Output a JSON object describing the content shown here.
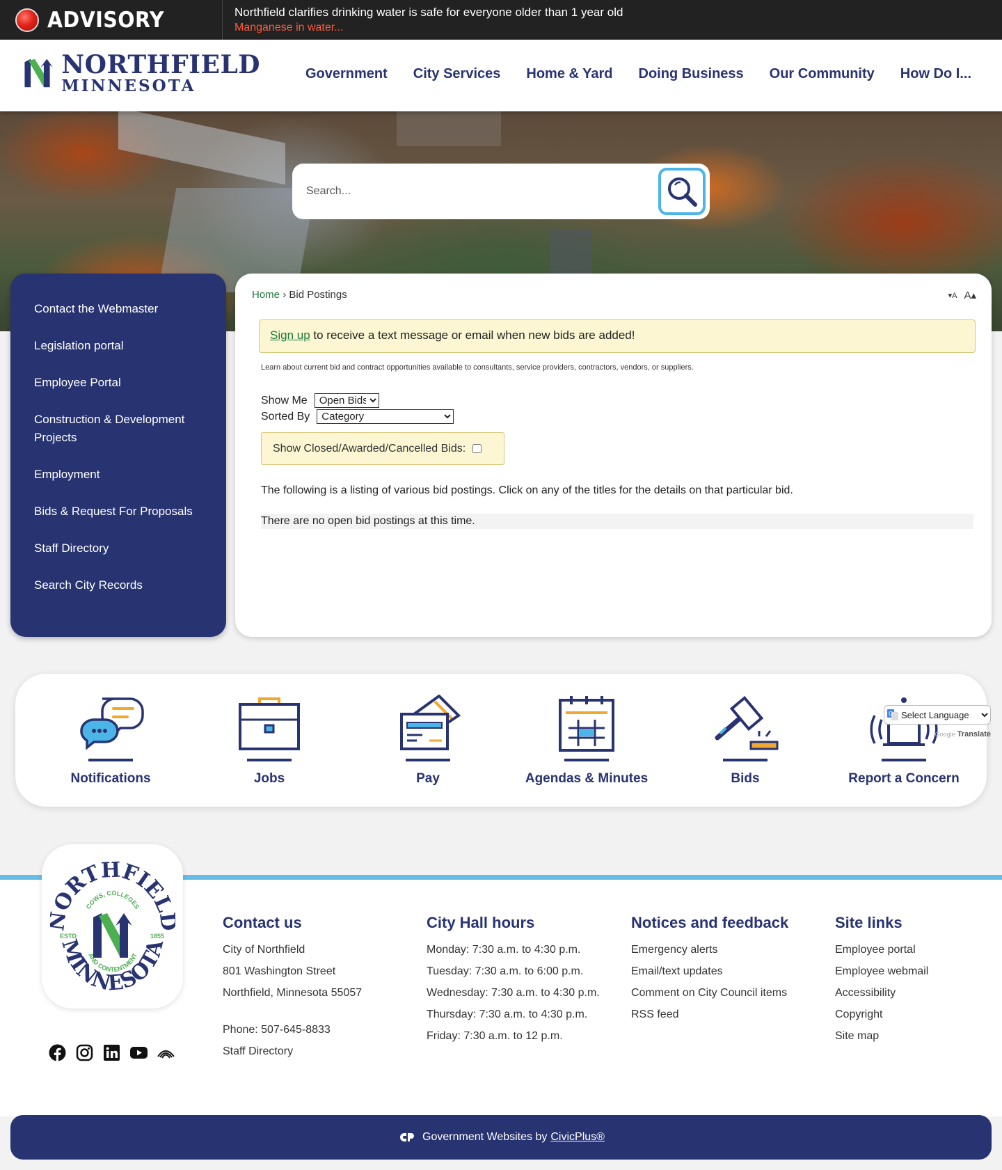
{
  "advisory": {
    "label": "ADVISORY",
    "title": "Northfield clarifies drinking water is safe for everyone older than 1 year old",
    "link": "Manganese in water..."
  },
  "logo": {
    "line1": "NORTHFIELD",
    "line2": "MINNESOTA"
  },
  "nav": {
    "items": [
      "Government",
      "City Services",
      "Home & Yard",
      "Doing Business",
      "Our Community",
      "How Do I..."
    ]
  },
  "search": {
    "placeholder": "Search..."
  },
  "sidebar": {
    "items": [
      "Contact the Webmaster",
      "Legislation portal",
      "Employee Portal",
      "Construction & Development Projects",
      "Employment",
      "Bids & Request For Proposals",
      "Staff Directory",
      "Search City Records"
    ]
  },
  "breadcrumb": {
    "home": "Home",
    "separator": "›",
    "current": "Bid Postings"
  },
  "font_resize": {
    "decrease": "▾A",
    "increase": "A▴"
  },
  "signup": {
    "link": "Sign up",
    "text": " to receive a text message or email when new bids are added!"
  },
  "learn_text": "Learn about current bid and contract opportunities available to consultants, service providers, contractors, vendors, or suppliers.",
  "filters": {
    "show_label": "Show Me",
    "show_value": "Open Bids",
    "sort_label": "Sorted By",
    "sort_value": "Category",
    "closed_label": "Show Closed/Awarded/Cancelled Bids:"
  },
  "listing_desc": "The following is a listing of various bid postings. Click on any of the titles for the details on that particular bid.",
  "no_bids": "There are no open bid postings at this time.",
  "quick_links": [
    {
      "label": "Notifications",
      "icon": "chat-bubbles-icon"
    },
    {
      "label": "Jobs",
      "icon": "briefcase-icon"
    },
    {
      "label": "Pay",
      "icon": "credit-card-icon"
    },
    {
      "label": "Agendas & Minutes",
      "icon": "calendar-icon"
    },
    {
      "label": "Bids",
      "icon": "gavel-icon"
    },
    {
      "label": "Report a Concern",
      "icon": "alarm-icon"
    }
  ],
  "translate": {
    "select_label": "Select Language",
    "powered_google": "Google",
    "powered_translate": "Translate"
  },
  "seal": {
    "top": "NORTHFIELD",
    "bottom": "MINNESOTA",
    "inner_top": "COWS, COLLEGES",
    "inner_bottom": "AND CONTENTMENT",
    "est": "ESTD",
    "year": "1855"
  },
  "footer": {
    "contact": {
      "heading": "Contact us",
      "lines": [
        "City of Northfield",
        "801 Washington Street",
        "Northfield, Minnesota 55057"
      ],
      "phone": "Phone: 507-645-8833",
      "staff": "Staff Directory"
    },
    "hours": {
      "heading": "City Hall hours",
      "lines": [
        "Monday: 7:30 a.m. to 4:30 p.m.",
        "Tuesday: 7:30 a.m. to 6:00 p.m.",
        "Wednesday: 7:30 a.m. to 4:30 p.m.",
        "Thursday: 7:30 a.m. to 4:30 p.m.",
        "Friday: 7:30 a.m. to 12 p.m."
      ]
    },
    "notices": {
      "heading": "Notices and feedback",
      "lines": [
        "Emergency alerts",
        "Email/text updates",
        "Comment on City Council items",
        "RSS feed"
      ]
    },
    "sitelinks": {
      "heading": "Site links",
      "lines": [
        "Employee portal",
        "Employee webmail",
        "Accessibility",
        "Copyright",
        "Site map"
      ]
    }
  },
  "civicplus": {
    "text": "Government Websites by",
    "link": "CivicPlus®"
  },
  "colors": {
    "navy": "#283371",
    "accent_blue": "#4cb5e8",
    "green": "#4caf50",
    "advisory_red": "#ff5a3a",
    "notice_yellow": "#fcf6d2"
  }
}
